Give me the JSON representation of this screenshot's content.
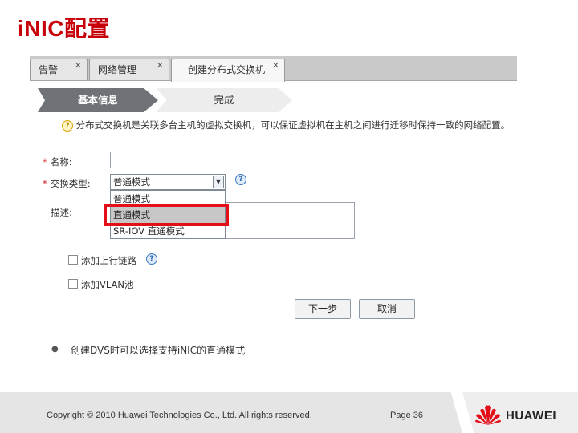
{
  "slide": {
    "title": "iNIC配置",
    "bullet": "创建DVS时可以选择支持iNIC的直通模式",
    "copyright": "Copyright © 2010 Huawei Technologies Co., Ltd. All rights reserved.",
    "page": "Page 36",
    "brand": "HUAWEI",
    "brand_color": "#e3101a",
    "title_color": "#c8000a"
  },
  "tabs": [
    {
      "label": "告警",
      "close": "✕"
    },
    {
      "label": "网络管理",
      "close": "✕"
    },
    {
      "label": "创建分布式交换机",
      "close": "✕"
    }
  ],
  "wizard": {
    "steps": [
      "基本信息",
      "完成"
    ],
    "hint": "分布式交换机是关联多台主机的虚拟交换机，可以保证虚拟机在主机之间进行迁移时保持一致的网络配置。"
  },
  "form": {
    "name_label": "名称:",
    "name_value": "",
    "type_label": "交换类型:",
    "type_value": "普通模式",
    "type_options": [
      "普通模式",
      "直通模式",
      "SR-IOV 直通模式"
    ],
    "highlighted_option": "直通模式",
    "desc_label": "描述:",
    "uplink_label": "添加上行链路",
    "vlan_label": "添加VLAN池",
    "next_button": "下一步",
    "cancel_button": "取消",
    "required_mark": "*"
  }
}
